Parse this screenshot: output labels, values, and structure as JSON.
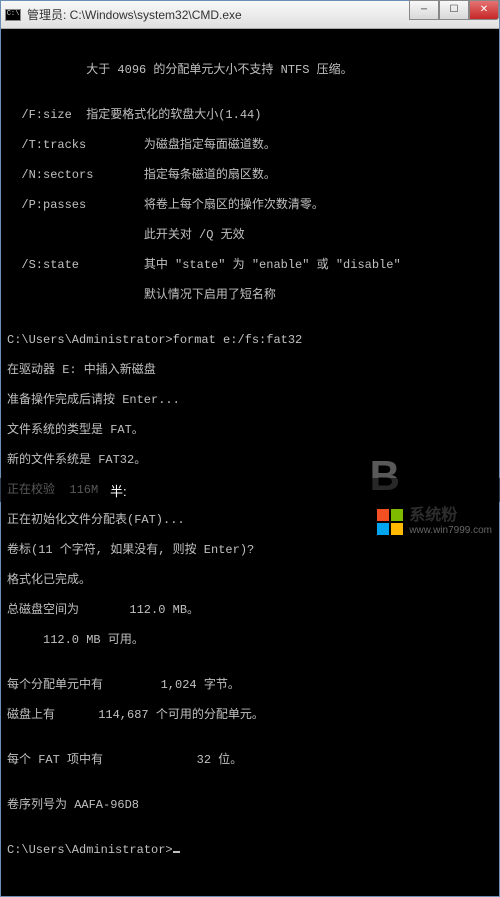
{
  "titlebar": {
    "icon_label": "C:\\",
    "title": "管理员: C:\\Windows\\system32\\CMD.exe"
  },
  "controls": {
    "min": "─",
    "max": "☐",
    "close": "✕"
  },
  "lines": {
    "l0": "",
    "l1": "           大于 4096 的分配单元大小不支持 NTFS 压缩。",
    "l2": "",
    "l3": "  /F:size  指定要格式化的软盘大小(1.44)",
    "l4": "  /T:tracks        为磁盘指定每面磁道数。",
    "l5": "  /N:sectors       指定每条磁道的扇区数。",
    "l6": "  /P:passes        将卷上每个扇区的操作次数清零。",
    "l7": "                   此开关对 /Q 无效",
    "l8": "  /S:state         其中 \"state\" 为 \"enable\" 或 \"disable\"",
    "l9": "                   默认情况下启用了短名称",
    "l10": "",
    "l11": "C:\\Users\\Administrator>format e:/fs:fat32",
    "l12": "在驱动器 E: 中插入新磁盘",
    "l13": "准备操作完成后请按 Enter...",
    "l14": "文件系统的类型是 FAT。",
    "l15": "新的文件系统是 FAT32。",
    "l16": "正在校验  116M",
    "l17": "正在初始化文件分配表(FAT)...",
    "l18": "卷标(11 个字符, 如果没有, 则按 Enter)?",
    "l19": "格式化已完成。",
    "l20": "总磁盘空间为       112.0 MB。",
    "l21": "     112.0 MB 可用。",
    "l22": "",
    "l23": "每个分配单元中有        1,024 字节。",
    "l24": "磁盘上有      114,687 个可用的分配单元。",
    "l25": "",
    "l26": "每个 FAT 项中有             32 位。",
    "l27": "",
    "l28": "卷序列号为 AAFA-96D8",
    "l29": "",
    "l30": "C:\\Users\\Administrator>"
  },
  "caption": "半:",
  "big_letter": "B",
  "watermark": {
    "cn": "系统粉",
    "url": "www.win7999.com"
  }
}
